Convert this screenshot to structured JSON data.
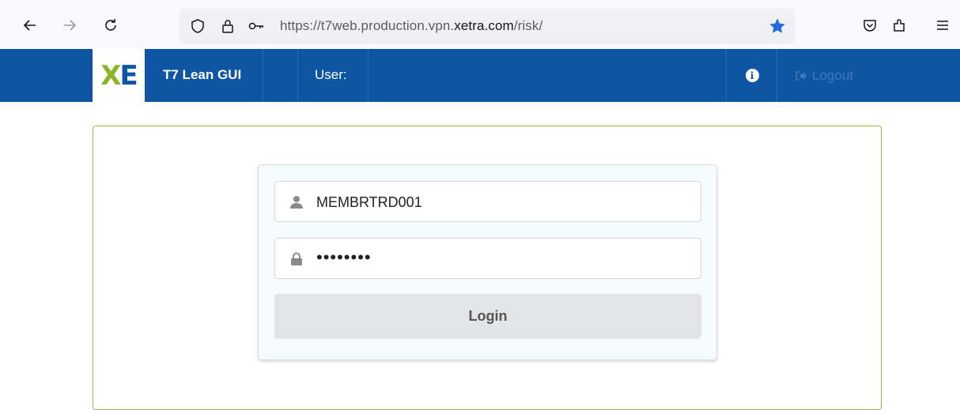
{
  "browser": {
    "url_prefix": "https://t7web.production.vpn.",
    "url_domain": "xetra.com",
    "url_suffix": "/risk/",
    "star_color": "#1f6cde"
  },
  "navbar": {
    "logo_letter_x": "X",
    "logo_letter_e": "E",
    "app_title": "T7 Lean GUI",
    "user_label": "User:",
    "logout_label": "Logout",
    "background": "#0e56a3"
  },
  "login": {
    "username_value": "MEMBRTRD001",
    "password_value": "••••••••",
    "login_button_label": "Login"
  }
}
